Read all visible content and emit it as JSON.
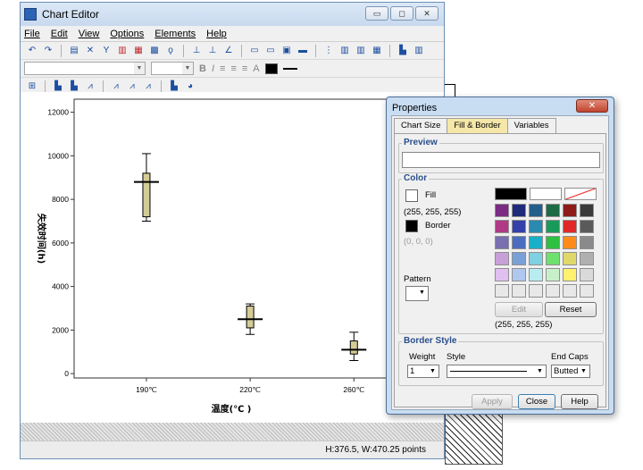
{
  "editor": {
    "title": "Chart Editor",
    "menu": [
      "File",
      "Edit",
      "View",
      "Options",
      "Elements",
      "Help"
    ],
    "status": "H:376.5, W:470.25 points"
  },
  "chart_data": {
    "type": "boxplot",
    "categories": [
      "190℃",
      "220℃",
      "260℃"
    ],
    "boxes": [
      {
        "category": "190℃",
        "min": 7000,
        "q1": 7200,
        "median": 8800,
        "q3": 9200,
        "max": 10100
      },
      {
        "category": "220℃",
        "min": 1800,
        "q1": 2100,
        "median": 2500,
        "q3": 3100,
        "max": 3200
      },
      {
        "category": "260℃",
        "min": 600,
        "q1": 900,
        "median": 1100,
        "q3": 1500,
        "max": 1900
      }
    ],
    "yticks": [
      "0",
      "2000",
      "4000",
      "6000",
      "8000",
      "10000",
      "12000"
    ],
    "ylim": [
      -200,
      12600
    ],
    "xlabel": "温度(℃ )",
    "ylabel": "失效时间(h)",
    "box_color": "#d4cc96"
  },
  "dialog": {
    "title": "Properties",
    "close": "✕",
    "tabs": [
      "Chart Size",
      "Fill & Border",
      "Variables"
    ],
    "active_tab": "Fill & Border",
    "preview_label": "Preview",
    "color_label": "Color",
    "fill_label": "Fill",
    "fill_value": "(255, 255, 255)",
    "border_label": "Border",
    "border_value": "(0, 0, 0)",
    "pattern_label": "Pattern",
    "edit_label": "Edit",
    "reset_label": "Reset",
    "selected_value": "(255, 255, 255)",
    "border_style_label": "Border Style",
    "weight_label": "Weight",
    "weight_value": "1",
    "style_label": "Style",
    "endcaps_label": "End Caps",
    "endcaps_value": "Butted",
    "apply_label": "Apply",
    "close_label": "Close",
    "help_label": "Help",
    "palette": [
      [
        "#7b2b83",
        "#1f2a7a",
        "#235f8a",
        "#1d6b46",
        "#8f1a1a",
        "#3a3a3a"
      ],
      [
        "#b03a86",
        "#3341a8",
        "#2a8ab0",
        "#1a9a5a",
        "#e02828",
        "#5a5a5a"
      ],
      [
        "#7a6fb0",
        "#4a6dbf",
        "#18b0c8",
        "#2ec040",
        "#ff8c1a",
        "#8a8a8a"
      ],
      [
        "#c8a0d8",
        "#7aa0d8",
        "#7fd0e0",
        "#6ee06e",
        "#e0d86a",
        "#b0b0b0"
      ],
      [
        "#e0c0f0",
        "#b0c8f0",
        "#b8ecf0",
        "#c8f0c8",
        "#fff070",
        "#dadada"
      ],
      [
        "#e8e8e8",
        "#e8e8e8",
        "#e8e8e8",
        "#e8e8e8",
        "#e8e8e8",
        "#e8e8e8"
      ]
    ]
  }
}
